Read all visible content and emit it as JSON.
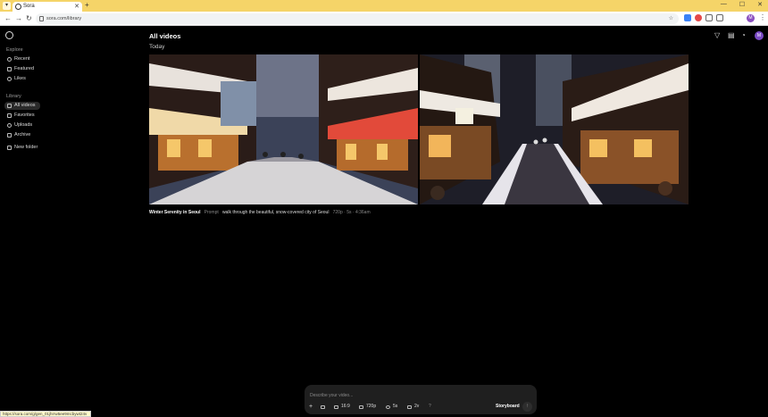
{
  "browser": {
    "tab_title": "Sora",
    "url": "sora.com/library",
    "status_url": "https://sora.com/g/gen_01jhrrw5ee9mcbywt24v"
  },
  "sidebar": {
    "explore_heading": "Explore",
    "explore_items": [
      {
        "label": "Recent",
        "icon": "clock-icon"
      },
      {
        "label": "Featured",
        "icon": "star-icon"
      },
      {
        "label": "Likes",
        "icon": "heart-icon"
      }
    ],
    "library_heading": "Library",
    "library_items": [
      {
        "label": "All videos",
        "icon": "grid-icon",
        "active": true
      },
      {
        "label": "Favorites",
        "icon": "star-icon"
      },
      {
        "label": "Uploads",
        "icon": "upload-icon"
      },
      {
        "label": "Archive",
        "icon": "archive-icon"
      }
    ],
    "new_folder": "New folder"
  },
  "main": {
    "title": "All videos",
    "section": "Today",
    "video": {
      "title": "Winter Serenity in Seoul",
      "prompt_label": "Prompt",
      "prompt": "walk through the beautiful, snow-covered city of Seoul",
      "resolution": "720p",
      "duration": "5s",
      "time": "4:36am"
    }
  },
  "composer": {
    "placeholder": "Describe your video...",
    "aspect": "16:9",
    "resolution": "720p",
    "duration": "5s",
    "variations": "2v",
    "help": "?",
    "storyboard": "Storyboard"
  },
  "colors": {
    "tab_bar": "#f5d468",
    "background": "#000000",
    "composer_bg": "#1f1f1f",
    "avatar": "#7b4bc4"
  }
}
